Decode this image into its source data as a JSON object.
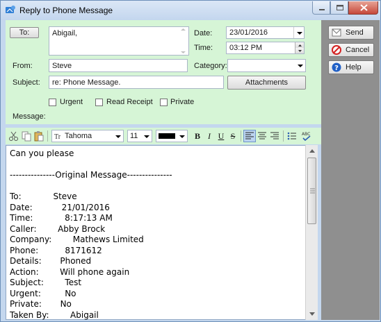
{
  "window": {
    "title": "Reply to Phone Message"
  },
  "form": {
    "to_button": "To:",
    "to_value": "Abigail,",
    "date_label": "Date:",
    "date_value": "23/01/2016",
    "time_label": "Time:",
    "time_value": "03:12 PM",
    "from_label": "From:",
    "from_value": "Steve",
    "category_label": "Category:",
    "category_value": "",
    "subject_label": "Subject:",
    "subject_value": "re: Phone Message.",
    "attachments_button": "Attachments",
    "urgent_label": "Urgent",
    "read_receipt_label": "Read Receipt",
    "private_label": "Private",
    "message_label": "Message:"
  },
  "sidebar": {
    "send": "Send",
    "cancel": "Cancel",
    "help": "Help"
  },
  "toolbar": {
    "font_name": "Tahoma",
    "font_size": "11",
    "text_color": "#000000"
  },
  "message_lines": [
    "Can you please",
    "",
    "---------------Original Message---------------",
    "",
    "To:            Steve",
    "Date:           21/01/2016",
    "Time:            8:17:13 AM",
    "Caller:        Abby Brock",
    "Company:        Mathews Limited",
    "Phone:          8171612",
    "Details:       Phoned",
    "Action:        Will phone again",
    "Subject:        Test",
    "Urgent:         No",
    "Private:       No",
    "Taken By:        Abigail"
  ]
}
